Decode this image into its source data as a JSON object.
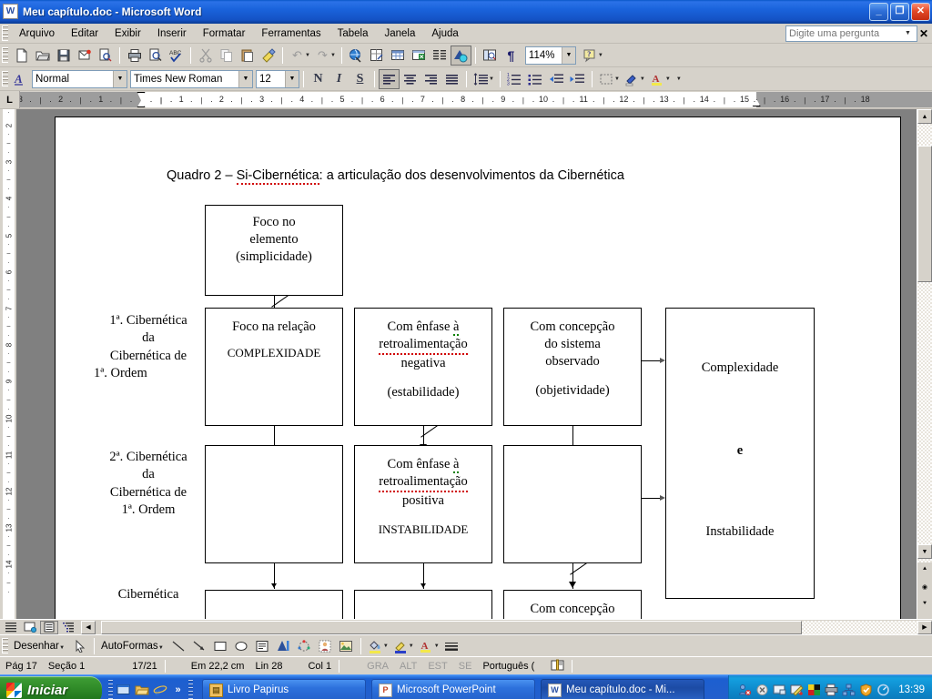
{
  "window": {
    "title": "Meu capítulo.doc - Microsoft Word",
    "app_icon": "word-icon",
    "minimize": "_",
    "restore": "❐",
    "close": "✕"
  },
  "menubar": {
    "items": [
      {
        "label": "Arquivo"
      },
      {
        "label": "Editar"
      },
      {
        "label": "Exibir"
      },
      {
        "label": "Inserir"
      },
      {
        "label": "Formatar"
      },
      {
        "label": "Ferramentas"
      },
      {
        "label": "Tabela"
      },
      {
        "label": "Janela"
      },
      {
        "label": "Ajuda"
      }
    ],
    "ask_placeholder": "Digite uma pergunta",
    "ask_value": "",
    "ask_close": "✕"
  },
  "standard_toolbar": {
    "buttons": [
      {
        "name": "new-document-icon",
        "glyph": "🗋"
      },
      {
        "name": "open-folder-icon",
        "glyph": "📂"
      },
      {
        "name": "save-icon",
        "glyph": "💾"
      },
      {
        "name": "email-icon",
        "glyph": "🖷"
      },
      {
        "name": "search-document-icon",
        "glyph": "🔍"
      },
      {
        "name": "print-icon",
        "glyph": "🖨"
      },
      {
        "name": "print-preview-icon",
        "glyph": "🔎"
      },
      {
        "name": "spelling-check-icon",
        "glyph": "ABC"
      },
      {
        "name": "cut-icon",
        "glyph": "✂"
      },
      {
        "name": "copy-icon",
        "glyph": "⧉"
      },
      {
        "name": "paste-icon",
        "glyph": "📋"
      },
      {
        "name": "format-painter-icon",
        "glyph": "🖌"
      },
      {
        "name": "undo-icon",
        "glyph": "↶"
      },
      {
        "name": "redo-icon",
        "glyph": "↷"
      },
      {
        "name": "insert-hyperlink-icon",
        "glyph": "🌐"
      },
      {
        "name": "tables-and-borders-icon",
        "glyph": "⊞"
      },
      {
        "name": "insert-table-icon",
        "glyph": "▦"
      },
      {
        "name": "insert-excel-worksheet-icon",
        "glyph": "▩"
      },
      {
        "name": "columns-icon",
        "glyph": "☰"
      },
      {
        "name": "drawing-icon",
        "glyph": "◩"
      },
      {
        "name": "document-map-icon",
        "glyph": "🗺"
      },
      {
        "name": "show-formatting-marks-icon",
        "glyph": "¶"
      }
    ],
    "zoom_value": "114%",
    "help_icon": "❓"
  },
  "formatting_toolbar": {
    "style_label": "Normal",
    "font_name": "Times New Roman",
    "font_size": "12",
    "bold": "N",
    "italic": "I",
    "underline": "S",
    "align_left": "≡",
    "align_center": "≡",
    "align_right": "≡",
    "justify": "≣",
    "line_spacing": "↕",
    "numbered_list": "⒈",
    "bulleted_list": "•",
    "decrease_indent": "⇤",
    "increase_indent": "⇥",
    "borders": "⊡",
    "highlight": "✎",
    "font_color": "A"
  },
  "ruler": {
    "tab_selector": "L",
    "unit": "cm",
    "left_labels": [
      "3",
      "2",
      "1"
    ],
    "right_labels": [
      "1",
      "2",
      "3",
      "4",
      "5",
      "6",
      "7",
      "8",
      "9",
      "10",
      "11",
      "12",
      "13",
      "14",
      "15",
      "16",
      "17",
      "18"
    ],
    "vertical_labels": [
      "2",
      "3",
      "4",
      "5",
      "6",
      "7",
      "8",
      "9",
      "10",
      "11",
      "12",
      "13",
      "14"
    ]
  },
  "document": {
    "diagram": {
      "title": "Quadro 2 – Si-Cibernética: a articulação dos desenvolvimentos da Cibernética",
      "title_misspelled_part": "Si-Cibernética",
      "top_box": "Foco no\nelemento\n(simplicidade)",
      "top_box_lines": [
        "Foco no",
        "elemento",
        "(simplicidade)"
      ],
      "row_labels": [
        "1ª. Cibernética\nda\nCibernética de\n1ª. Ordem",
        "2ª. Cibernética\nda\nCibernética de\n1ª. Ordem",
        "Cibernética"
      ],
      "row1": {
        "label_lines": [
          "1ª. Cibernética",
          "da",
          "Cibernética de",
          "1ª. Ordem"
        ],
        "col1_lines": [
          "Foco na relação",
          "COMPLEXIDADE"
        ],
        "col2_lines": [
          "Com ênfase à",
          "retroalimentação",
          "negativa",
          "(estabilidade)"
        ],
        "col3_lines": [
          "Com concepção",
          "do sistema",
          "observado",
          "(objetividade)"
        ]
      },
      "row2": {
        "label_lines": [
          "2ª. Cibernética",
          "da",
          "Cibernética de",
          "1ª. Ordem"
        ],
        "col1_lines": [],
        "col2_lines": [
          "Com ênfase à",
          "retroalimentação",
          "positiva",
          "INSTABILIDADE"
        ],
        "col3_lines": []
      },
      "row3": {
        "label_lines": [
          "Cibernética"
        ],
        "col3_partial": "Com concepção"
      },
      "result_box": {
        "line1": "Complexidade",
        "line2": "e",
        "line3": "Instabilidade"
      }
    }
  },
  "drawing_toolbar": {
    "draw_menu": "Desenhar",
    "select_objects": "select-arrow-icon",
    "autoshapes_menu": "AutoFormas",
    "buttons": [
      {
        "name": "line-icon",
        "glyph": "╲"
      },
      {
        "name": "arrow-icon",
        "glyph": "↘"
      },
      {
        "name": "rectangle-icon",
        "glyph": "▭"
      },
      {
        "name": "oval-icon",
        "glyph": "◯"
      },
      {
        "name": "text-box-icon",
        "glyph": "🗒"
      },
      {
        "name": "wordart-icon",
        "glyph": "🅰"
      },
      {
        "name": "diagram-icon",
        "glyph": "✣"
      },
      {
        "name": "clip-art-icon",
        "glyph": "🖼"
      },
      {
        "name": "insert-picture-icon",
        "glyph": "🏞"
      },
      {
        "name": "fill-color-icon",
        "glyph": "🪣"
      },
      {
        "name": "line-color-icon",
        "glyph": "✒"
      },
      {
        "name": "font-color-icon",
        "glyph": "A"
      },
      {
        "name": "line-style-icon",
        "glyph": "≡"
      }
    ]
  },
  "statusbar": {
    "page": "Pág  17",
    "section": "Seção  1",
    "pages": "17/21",
    "at": "Em  22,2 cm",
    "line": "Lin  28",
    "column": "Col  1",
    "rec": "GRA",
    "trk": "ALT",
    "ext": "EST",
    "ovr": "SE",
    "language": "Português (",
    "spellcheck_icon": "book-icon"
  },
  "view_buttons": [
    {
      "name": "normal-view-button",
      "glyph": "☰"
    },
    {
      "name": "web-layout-view-button",
      "glyph": "🖳"
    },
    {
      "name": "print-layout-view-button",
      "glyph": "▤"
    },
    {
      "name": "outline-view-button",
      "glyph": "☳"
    }
  ],
  "taskbar": {
    "start_label": "Iniciar",
    "quick_launch": [
      {
        "name": "show-desktop-icon",
        "glyph": "🖵"
      },
      {
        "name": "folder-icon",
        "glyph": "📁"
      },
      {
        "name": "internet-explorer-icon",
        "glyph": "e"
      },
      {
        "name": "chevron-right-icon",
        "glyph": "»"
      }
    ],
    "tasks": [
      {
        "label": "Livro Papirus",
        "icon": "folder-icon",
        "active": false
      },
      {
        "label": "Microsoft PowerPoint",
        "icon": "powerpoint-icon",
        "active": false
      },
      {
        "label": "Meu capítulo.doc - Mi...",
        "icon": "word-icon",
        "active": true
      }
    ],
    "tray_icons": [
      {
        "name": "network-users-icon",
        "glyph": "👥"
      },
      {
        "name": "disconnect-icon",
        "glyph": "✖"
      },
      {
        "name": "monitor-icon",
        "glyph": "🖥"
      },
      {
        "name": "pencil-tool-icon",
        "glyph": "✏"
      },
      {
        "name": "color-palette-icon",
        "glyph": "▤"
      },
      {
        "name": "printer-icon",
        "glyph": "🖨"
      },
      {
        "name": "network-icon",
        "glyph": "🖧"
      },
      {
        "name": "security-icon",
        "glyph": "🛡"
      },
      {
        "name": "power-icon",
        "glyph": "◐"
      }
    ],
    "clock": "13:39"
  }
}
